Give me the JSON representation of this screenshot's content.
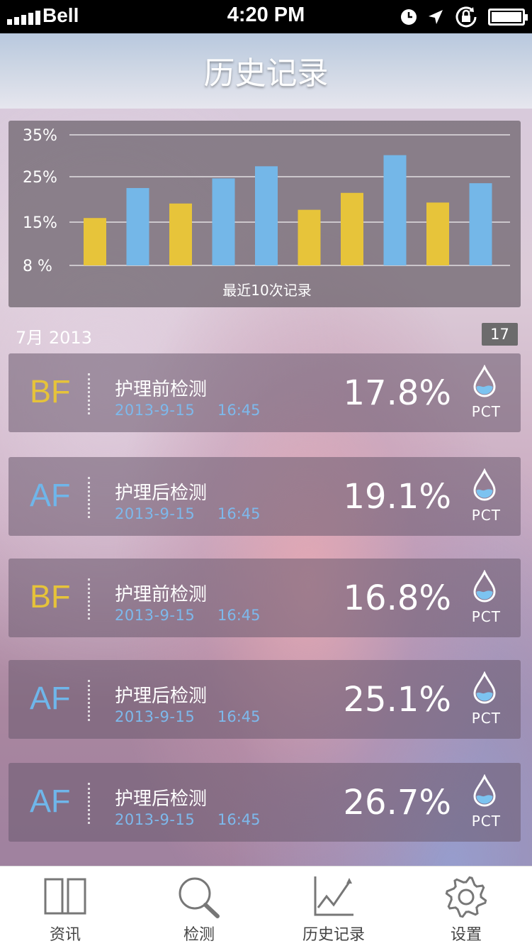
{
  "status_bar": {
    "carrier": "Bell",
    "time": "4:20 PM"
  },
  "nav": {
    "title": "历史记录"
  },
  "chart_data": {
    "type": "bar",
    "xlabel": "最近10次记录",
    "ytick_labels": [
      "35%",
      "25%",
      "15%",
      "8 %"
    ],
    "ylim": [
      8,
      35
    ],
    "values": [
      17.8,
      24.0,
      20.8,
      26.0,
      28.5,
      19.5,
      23.0,
      30.8,
      21.0,
      25.0
    ],
    "colors": [
      "#e7c43a",
      "#74b7e8",
      "#e7c43a",
      "#74b7e8",
      "#74b7e8",
      "#e7c43a",
      "#e7c43a",
      "#74b7e8",
      "#e7c43a",
      "#74b7e8"
    ],
    "grid": true
  },
  "section": {
    "month": "7月 2013",
    "count": "17"
  },
  "records": [
    {
      "tag": "BF",
      "name": "护理前检测",
      "date": "2013-9-15",
      "time": "16:45",
      "value": "17.8%",
      "unit": "PCT"
    },
    {
      "tag": "AF",
      "name": "护理后检测",
      "date": "2013-9-15",
      "time": "16:45",
      "value": "19.1%",
      "unit": "PCT"
    },
    {
      "tag": "BF",
      "name": "护理前检测",
      "date": "2013-9-15",
      "time": "16:45",
      "value": "16.8%",
      "unit": "PCT"
    },
    {
      "tag": "AF",
      "name": "护理后检测",
      "date": "2013-9-15",
      "time": "16:45",
      "value": "25.1%",
      "unit": "PCT"
    },
    {
      "tag": "AF",
      "name": "护理后检测",
      "date": "2013-9-15",
      "time": "16:45",
      "value": "26.7%",
      "unit": "PCT"
    }
  ],
  "tabs": [
    {
      "label": "资讯",
      "icon": "book-icon"
    },
    {
      "label": "检测",
      "icon": "magnifier-icon"
    },
    {
      "label": "历史记录",
      "icon": "line-chart-icon"
    },
    {
      "label": "设置",
      "icon": "gear-icon"
    }
  ],
  "colors": {
    "bf": "#e6c33a",
    "af": "#6fb6ea",
    "date": "#7db9ec"
  }
}
